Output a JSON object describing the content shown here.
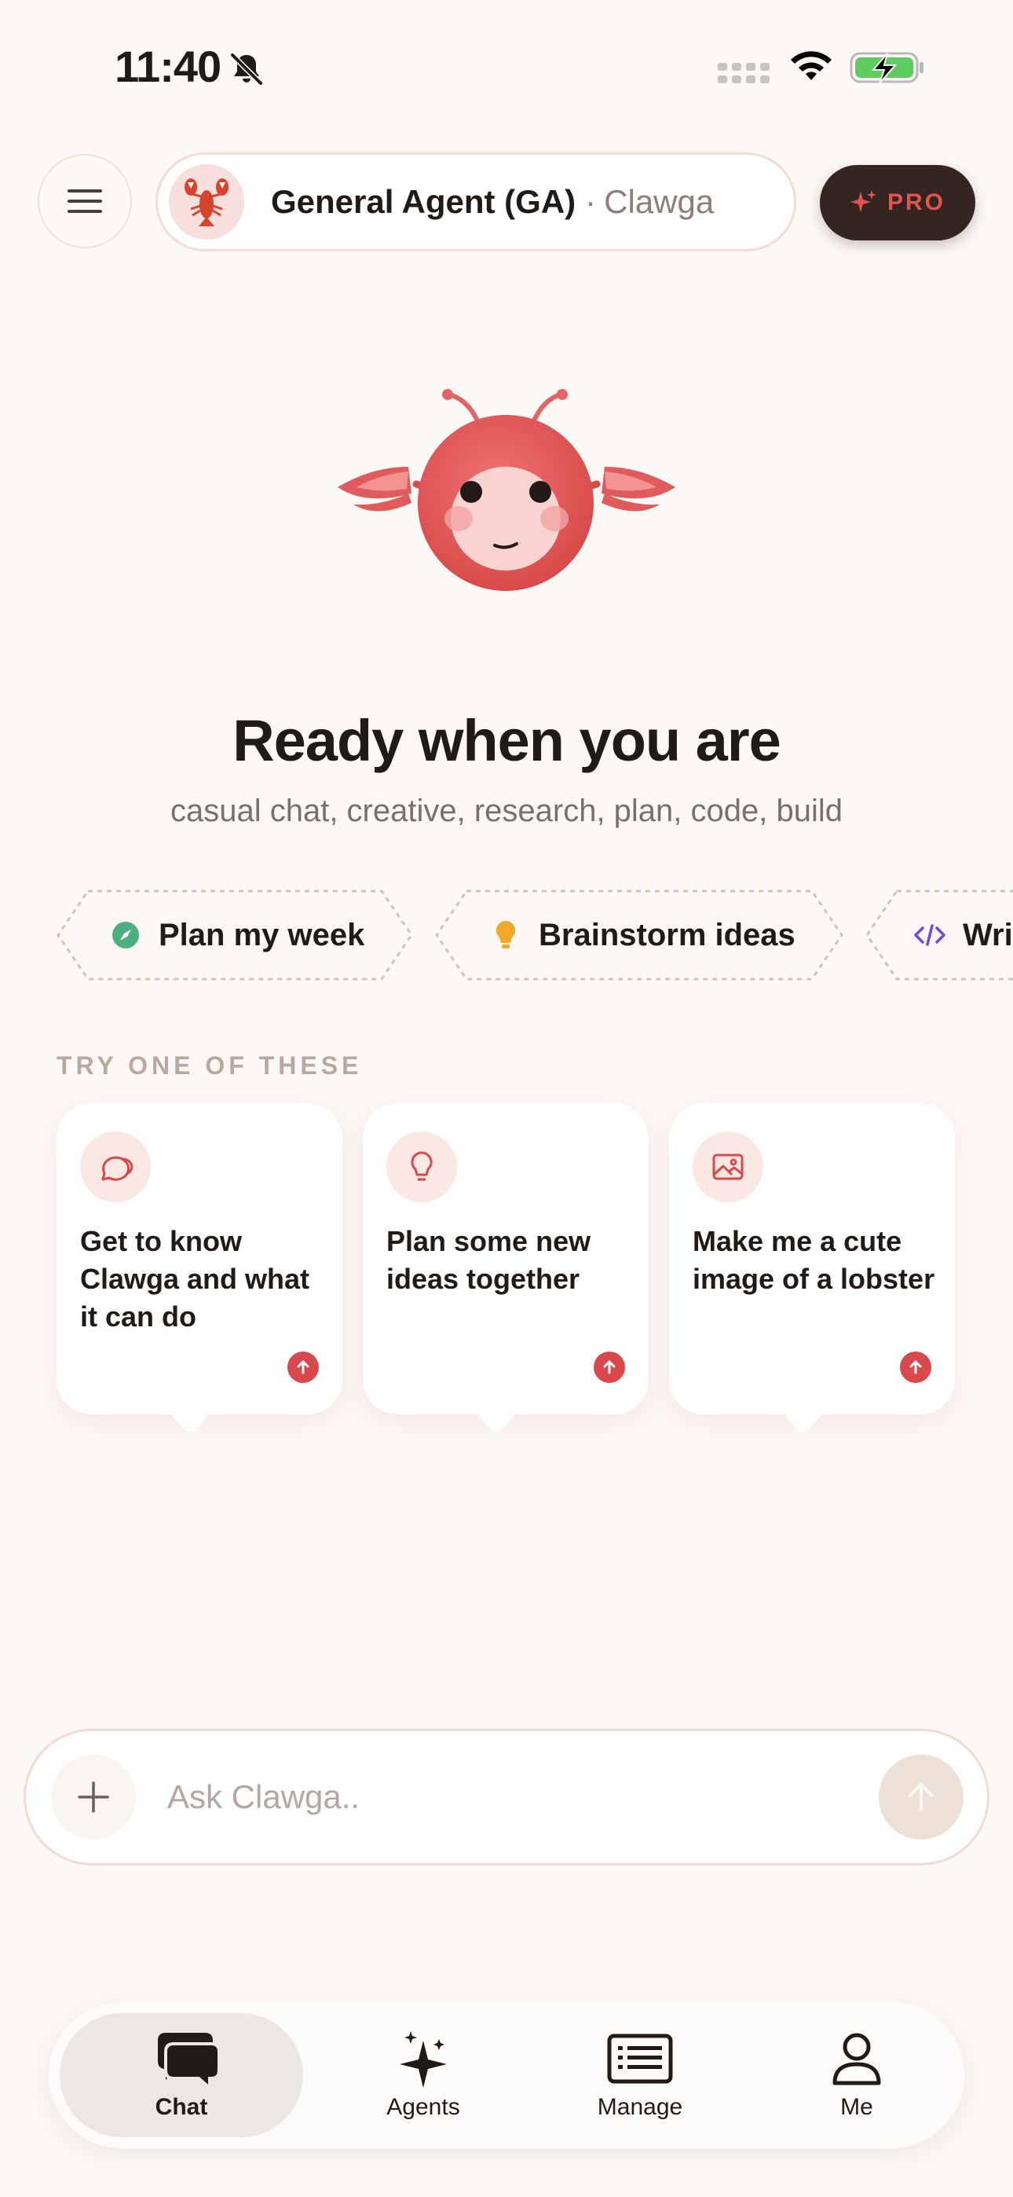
{
  "status_bar": {
    "time": "11:40",
    "icons": [
      "bell-slash-icon",
      "cellular-signal-icon",
      "wifi-icon",
      "battery-charging-icon"
    ]
  },
  "header": {
    "menu_icon": "hamburger-menu-icon",
    "agent_avatar": "🦞",
    "agent_name": "General Agent (GA)",
    "agent_separator": "·",
    "agent_brand": "Clawga",
    "pro_label": "PRO",
    "pro_icon": "sparkle-icon"
  },
  "hero": {
    "title": "Ready when you are",
    "subtitle": "casual chat, creative, research, plan, code, build"
  },
  "chips": [
    {
      "label": "Plan my week",
      "icon": "compass-icon",
      "color": "#4caf7d"
    },
    {
      "label": "Brainstorm ideas",
      "icon": "lightbulb-icon",
      "color": "#f0a928"
    },
    {
      "label": "Wri",
      "icon": "code-icon",
      "color": "#6b4be0"
    }
  ],
  "section_label": "TRY ONE OF THESE",
  "cards": [
    {
      "text": "Get to know Clawga and what it can do",
      "icon": "chat-bubbles-icon"
    },
    {
      "text": "Plan some new ideas together",
      "icon": "lightbulb-icon"
    },
    {
      "text": "Make me a cute image of a lobster",
      "icon": "image-icon"
    }
  ],
  "input": {
    "placeholder": "Ask Clawga..",
    "value": ""
  },
  "tabs": [
    {
      "label": "Chat",
      "icon": "chat-bubbles-icon",
      "active": true
    },
    {
      "label": "Agents",
      "icon": "sparkles-icon",
      "active": false
    },
    {
      "label": "Manage",
      "icon": "newspaper-icon",
      "active": false
    },
    {
      "label": "Me",
      "icon": "person-icon",
      "active": false
    }
  ],
  "colors": {
    "background": "#fcf8f6",
    "accent": "#d9484a",
    "text": "#211b18",
    "muted": "#7a706b"
  }
}
